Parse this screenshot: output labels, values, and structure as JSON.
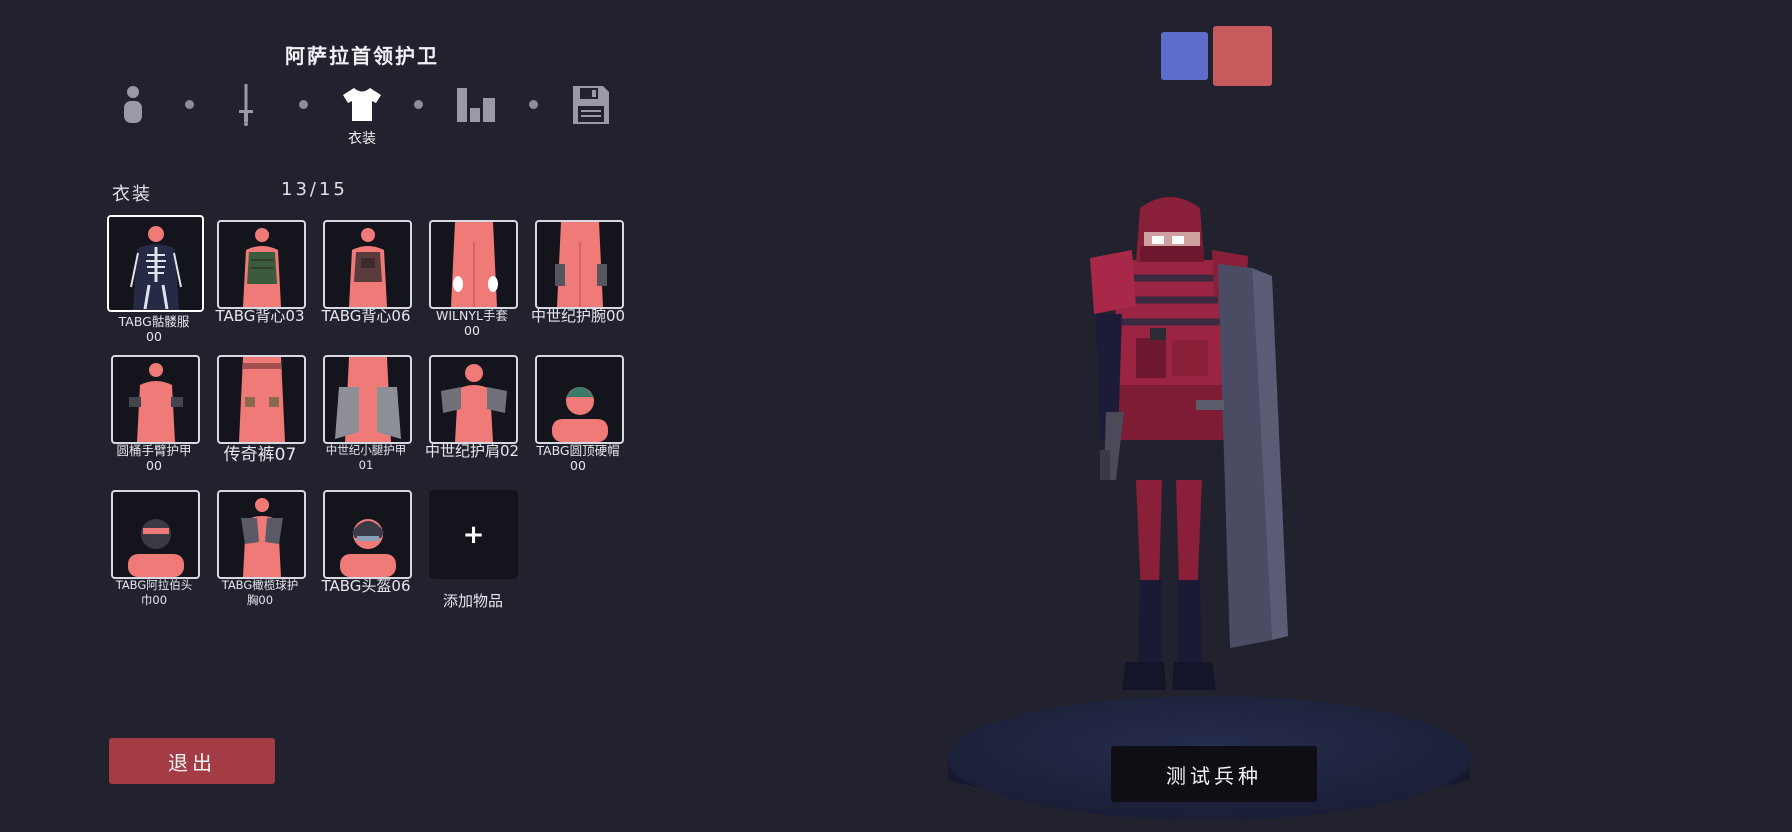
{
  "header": {
    "unit_name": "阿萨拉首领护卫",
    "active_step_label": "衣装",
    "steps": [
      {
        "icon": "unit-base-icon",
        "label": ""
      },
      {
        "icon": "weapon-icon",
        "label": ""
      },
      {
        "icon": "clothing-icon",
        "label": "衣装"
      },
      {
        "icon": "stats-icon",
        "label": ""
      },
      {
        "icon": "save-icon",
        "label": ""
      }
    ]
  },
  "clothing": {
    "section_label": "衣装",
    "count": "13/15",
    "items": [
      {
        "label": "TABG骷髅服\n00"
      },
      {
        "label": "TABG背心03"
      },
      {
        "label": "TABG背心06"
      },
      {
        "label": "WILNYL手套\n00"
      },
      {
        "label": "中世纪护腕00"
      },
      {
        "label": "圆桶手臂护甲\n00"
      },
      {
        "label": "传奇裤07"
      },
      {
        "label": "中世纪小腿护甲\n01"
      },
      {
        "label": "中世纪护肩02"
      },
      {
        "label": "TABG圆顶硬帽\n00"
      },
      {
        "label": "TABG阿拉伯头\n巾00"
      },
      {
        "label": "TABG橄榄球护\n胸00"
      },
      {
        "label": "TABG头盔06"
      }
    ],
    "add_label": "添加物品",
    "add_symbol": "+"
  },
  "footer": {
    "exit_label": "退出",
    "test_label": "测试兵种"
  },
  "team_colors": {
    "blue": "#5d6dc9",
    "red": "#c75a5d"
  },
  "colors": {
    "background": "#22222e",
    "exit_button": "#a33c44",
    "unit_body": "#f07a78",
    "armor": "#8a1f3a"
  }
}
